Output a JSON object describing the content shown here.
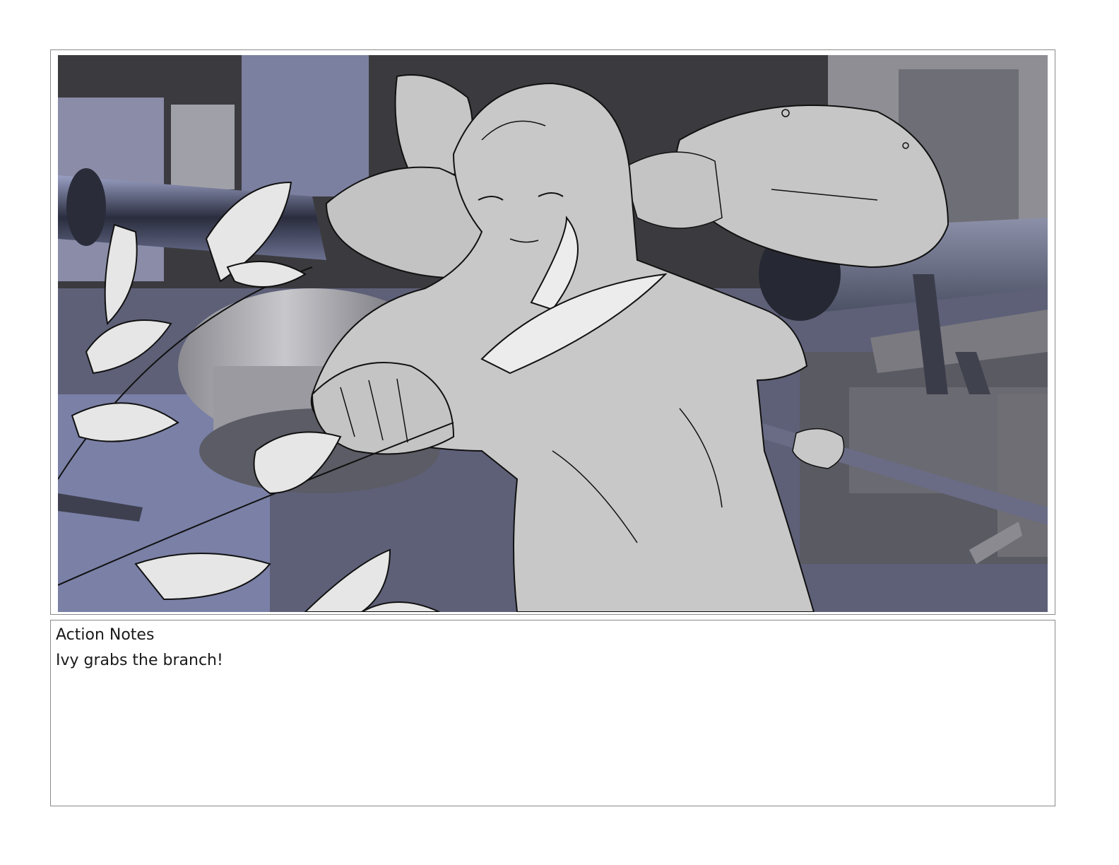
{
  "panel": {
    "illustration": "storyboard-sketch"
  },
  "notes": {
    "title": "Action Notes",
    "body": "Ivy grabs the branch!"
  },
  "colors": {
    "background_dark": "#3a3a3e",
    "machinery_blue": "#7a7f9e",
    "machinery_gray": "#9a9aa2",
    "figure_fill": "#c9c9c9",
    "leaf_fill": "#ececec",
    "line": "#111111"
  }
}
